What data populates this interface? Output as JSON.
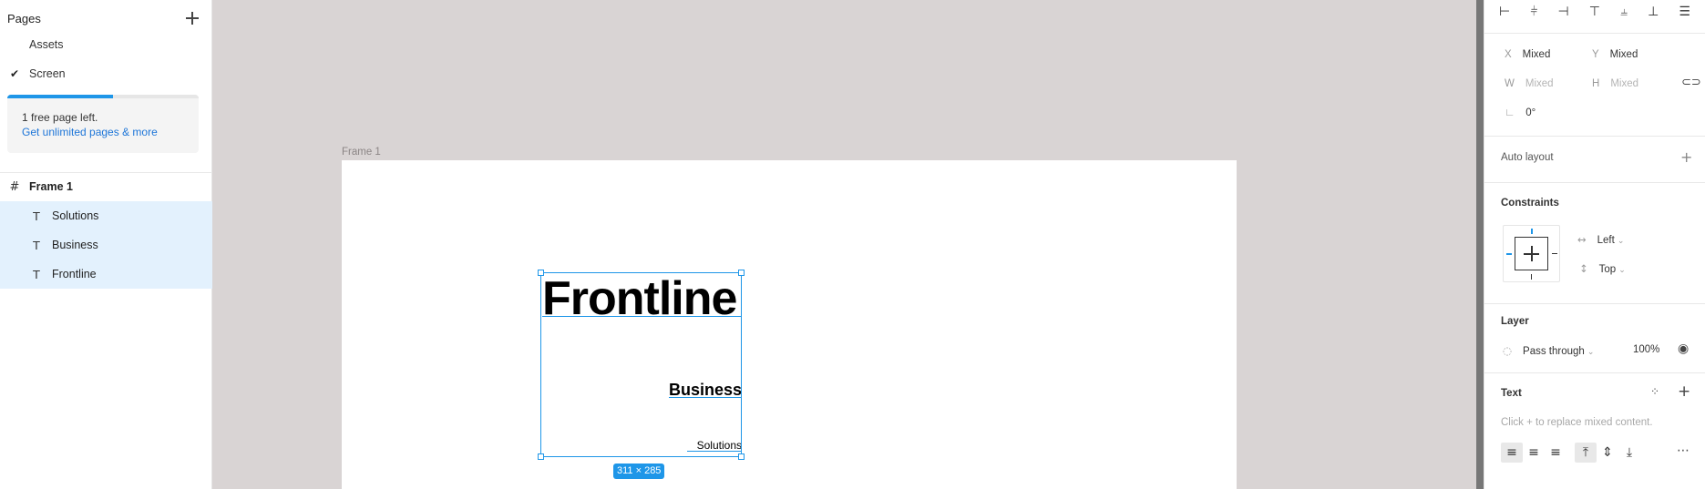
{
  "left_panel": {
    "pages_title": "Pages",
    "pages": [
      {
        "label": "Assets",
        "checked": false
      },
      {
        "label": "Screen",
        "checked": true
      }
    ],
    "usage_fraction": 0.55,
    "usage_text": "1 free page left.",
    "usage_link": "Get unlimited pages & more",
    "layers": {
      "frame": "Frame 1",
      "children": [
        "Solutions",
        "Business",
        "Frontline"
      ]
    },
    "accent": "#1e96e8"
  },
  "canvas": {
    "frame_label": "Frame 1",
    "text_frontline": "Frontline",
    "text_business": "Business",
    "text_solutions": "Solutions",
    "selection_dims": "311 × 285"
  },
  "right_panel": {
    "x_label": "X",
    "x_value": "Mixed",
    "y_label": "Y",
    "y_value": "Mixed",
    "w_label": "W",
    "w_value": "Mixed",
    "h_label": "H",
    "h_value": "Mixed",
    "rotation": "0°",
    "auto_layout": "Auto layout",
    "constraints": "Constraints",
    "constraint_h": "Left",
    "constraint_v": "Top",
    "layer": "Layer",
    "blend": "Pass through",
    "opacity": "100%",
    "text": "Text",
    "text_hint": "Click + to replace mixed content."
  }
}
